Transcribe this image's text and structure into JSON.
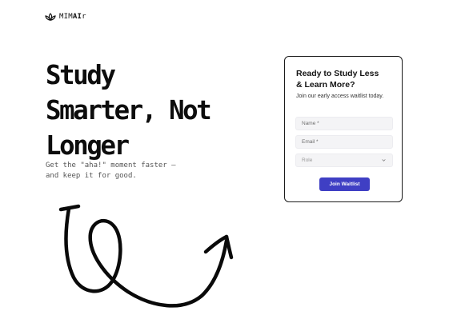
{
  "brand": {
    "name_light": "MIM",
    "name_bold": "AI",
    "name_suffix": "r",
    "icon": "lotus-icon"
  },
  "hero": {
    "title_lines": [
      "Study",
      "Smarter, Not",
      "Longer"
    ],
    "subtitle_lines": [
      "Get the \"aha!\" moment faster –",
      "and keep it for good."
    ]
  },
  "decoration": {
    "icon": "squiggle-arrow-icon"
  },
  "waitlist": {
    "title_lines": [
      "Ready to Study Less",
      "& Learn More?"
    ],
    "subtitle": "Join our early access waitlist today.",
    "fields": {
      "name": {
        "placeholder": "Name *",
        "value": ""
      },
      "email": {
        "placeholder": "Email *",
        "value": ""
      },
      "role": {
        "placeholder": "Role",
        "value": ""
      }
    },
    "submit_label": "Join Waitlist"
  },
  "colors": {
    "accent": "#3f3fc4",
    "text": "#111111",
    "field_bg": "#f4f4f6"
  }
}
